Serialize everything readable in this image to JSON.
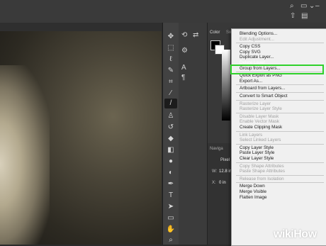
{
  "topbar": {
    "icons": [
      "search-icon",
      "workspace-icon",
      "chevron-down-icon",
      "share-icon"
    ]
  },
  "tools": [
    "move-tool",
    "marquee-tool",
    "lasso-tool",
    "quick-select-tool",
    "crop-tool",
    "eyedropper-tool",
    "healing-tool",
    "brush-tool",
    "stamp-tool",
    "history-brush-tool",
    "eraser-tool",
    "paint-bucket-tool",
    "blur-tool",
    "dodge-tool",
    "pen-tool",
    "type-tool",
    "path-select-tool",
    "rectangle-tool",
    "hand-tool",
    "zoom-tool",
    "more-tools",
    "color-swatches"
  ],
  "panels": {
    "color_tab": "Color",
    "swatches_tab": "Sw",
    "navigator_tab": "Naviga",
    "properties_tab": "Pixel",
    "w_label": "W:",
    "w_value": "12.8 in",
    "x_label": "X:",
    "x_value": "0 in"
  },
  "context_menu": {
    "groups": [
      [
        {
          "label": "Blending Options...",
          "disabled": false
        },
        {
          "label": "Edit Adjustment...",
          "disabled": true
        }
      ],
      [
        {
          "label": "Copy CSS",
          "disabled": false
        },
        {
          "label": "Copy SVG",
          "disabled": false
        },
        {
          "label": "Duplicate Layer...",
          "disabled": false
        },
        {
          "label": "Delete Layer",
          "disabled": false,
          "highlighted": true
        },
        {
          "label": "Group from Layers...",
          "disabled": false
        }
      ],
      [
        {
          "label": "Quick Export as PNG",
          "disabled": false
        },
        {
          "label": "Export As...",
          "disabled": false
        }
      ],
      [
        {
          "label": "Artboard from Layers...",
          "disabled": false
        }
      ],
      [
        {
          "label": "Convert to Smart Object",
          "disabled": false
        }
      ],
      [
        {
          "label": "Rasterize Layer",
          "disabled": true
        },
        {
          "label": "Rasterize Layer Style",
          "disabled": true
        }
      ],
      [
        {
          "label": "Disable Layer Mask",
          "disabled": true
        },
        {
          "label": "Enable Vector Mask",
          "disabled": true
        },
        {
          "label": "Create Clipping Mask",
          "disabled": false
        }
      ],
      [
        {
          "label": "Link Layers",
          "disabled": true
        },
        {
          "label": "Select Linked Layers",
          "disabled": true
        }
      ],
      [
        {
          "label": "Copy Layer Style",
          "disabled": false
        },
        {
          "label": "Paste Layer Style",
          "disabled": false
        },
        {
          "label": "Clear Layer Style",
          "disabled": false
        }
      ],
      [
        {
          "label": "Copy Shape Attributes",
          "disabled": true
        },
        {
          "label": "Paste Shape Attributes",
          "disabled": true
        }
      ],
      [
        {
          "label": "Release from Isolation",
          "disabled": true
        }
      ],
      [
        {
          "label": "Merge Down",
          "disabled": false
        },
        {
          "label": "Merge Visible",
          "disabled": false
        },
        {
          "label": "Flatten Image",
          "disabled": false
        }
      ]
    ]
  },
  "watermark": {
    "wiki": "wiki",
    "how": "How"
  },
  "colors": {
    "highlight_border": "#2fd12a",
    "selection": "#2c6bd4"
  }
}
